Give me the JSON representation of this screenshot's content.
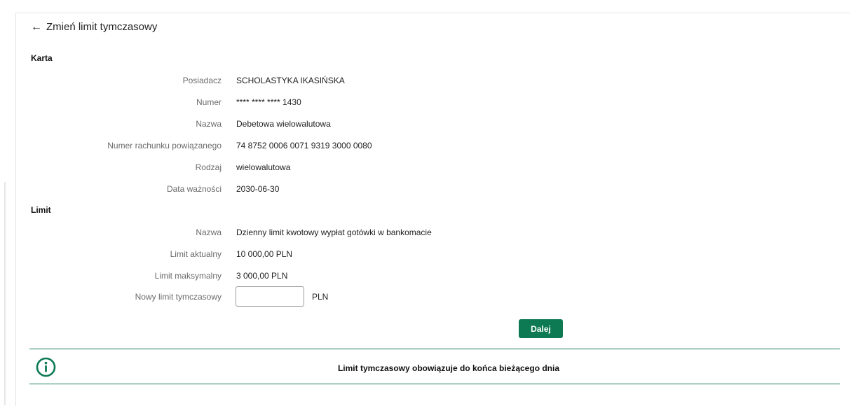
{
  "header": {
    "back_label": "Zmień limit tymczasowy"
  },
  "karta": {
    "title": "Karta",
    "rows": [
      {
        "label": "Posiadacz",
        "value": "SCHOLASTYKA IKASIŃSKA"
      },
      {
        "label": "Numer",
        "value": "**** **** **** 1430"
      },
      {
        "label": "Nazwa",
        "value": "Debetowa wielowalutowa"
      },
      {
        "label": "Numer rachunku powiązanego",
        "value": "74 8752 0006 0071 9319 3000 0080"
      },
      {
        "label": "Rodzaj",
        "value": "wielowalutowa"
      },
      {
        "label": "Data ważności",
        "value": "2030-06-30"
      }
    ]
  },
  "limit": {
    "title": "Limit",
    "rows": [
      {
        "label": "Nazwa",
        "value": "Dzienny limit kwotowy wypłat gotówki w bankomacie"
      },
      {
        "label": "Limit aktualny",
        "value": "10 000,00 PLN"
      },
      {
        "label": "Limit maksymalny",
        "value": "3 000,00 PLN"
      }
    ],
    "new_limit_label": "Nowy limit tymczasowy",
    "new_limit_value": "",
    "currency": "PLN"
  },
  "actions": {
    "next_label": "Dalej"
  },
  "info": {
    "text": "Limit tymczasowy obowiązuje do końca bieżącego dnia",
    "icon": "info-circle-icon",
    "accent_color": "#0d7a53"
  }
}
